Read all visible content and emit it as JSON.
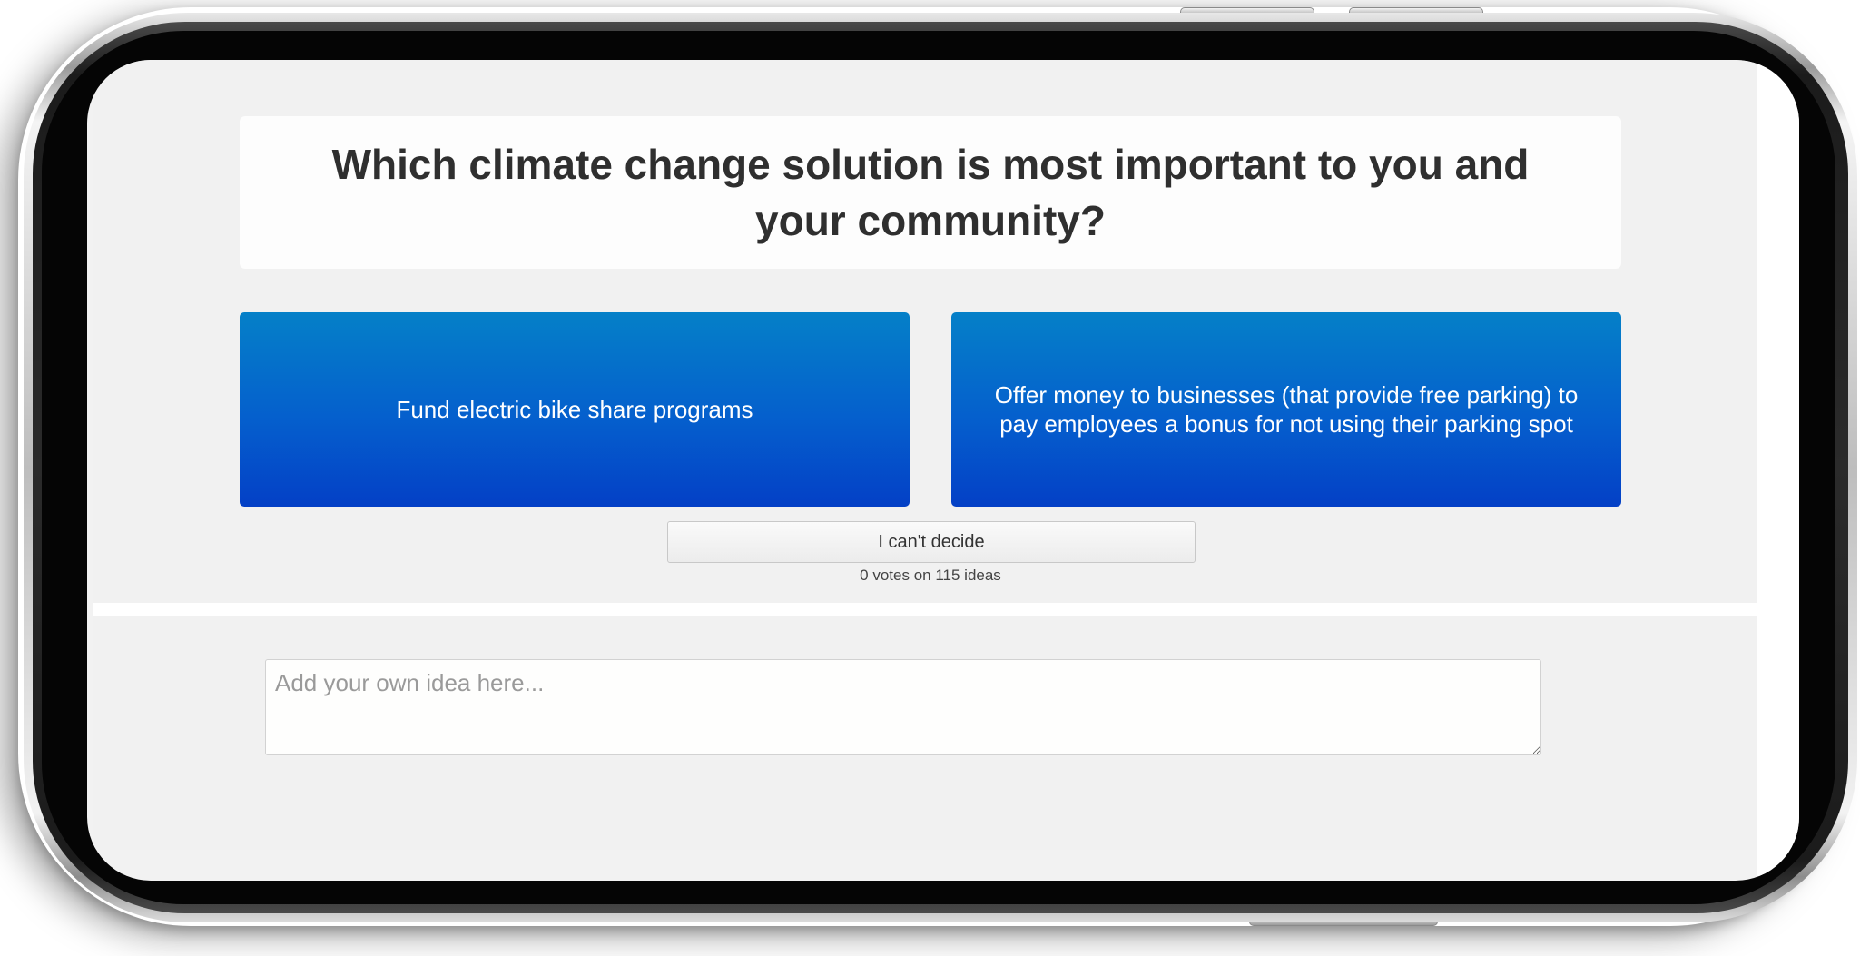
{
  "poll": {
    "question": "Which climate change solution is most important to you and your community?",
    "choice_left": "Fund electric bike share programs",
    "choice_right": "Offer money to businesses (that provide free parking) to pay employees a bonus for not using their parking spot",
    "cant_decide_label": "I can't decide",
    "vote_status": "0 votes on 115 ideas"
  },
  "idea_form": {
    "placeholder": "Add your own idea here...",
    "value": ""
  },
  "colors": {
    "choice_gradient_top": "#0580c8",
    "choice_gradient_bottom": "#0440c6",
    "page_background": "#f1f1f1",
    "question_text": "#2f2f2f"
  }
}
